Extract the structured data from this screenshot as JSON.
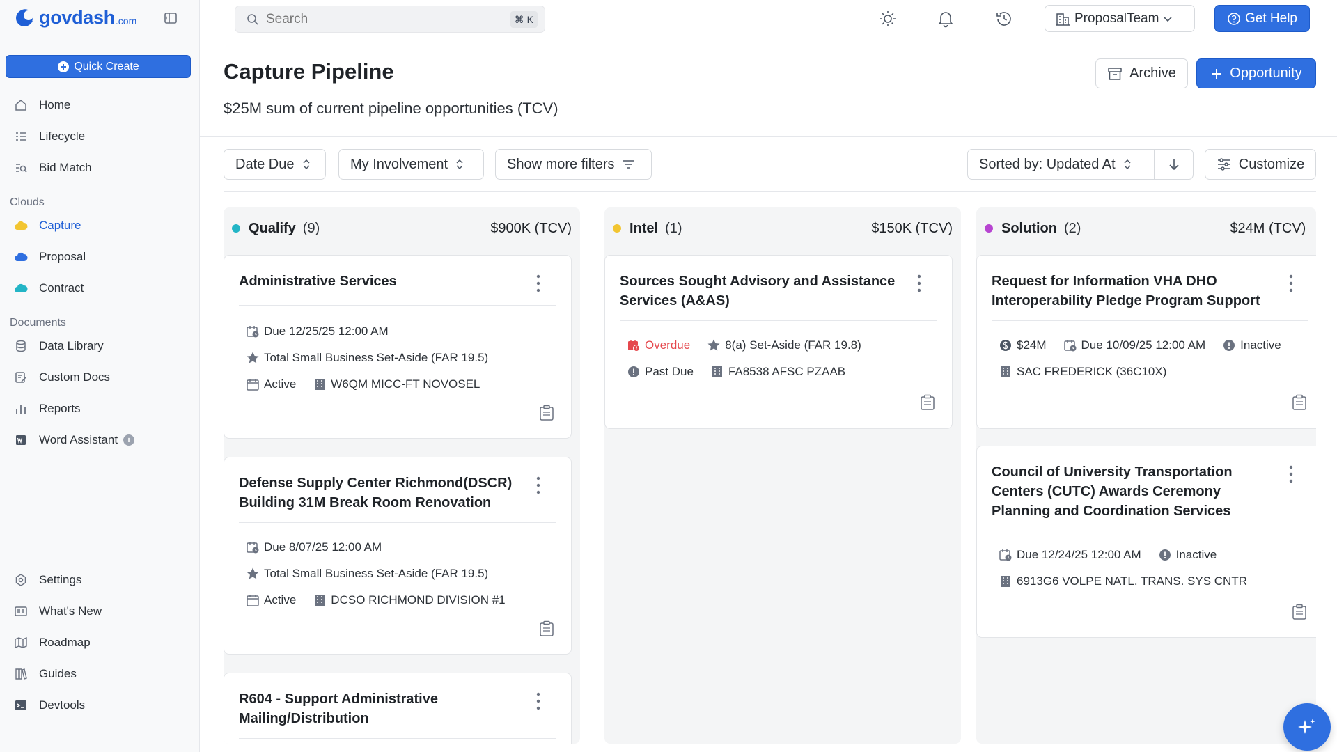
{
  "brand": {
    "name": "govdash",
    "suffix": ".com"
  },
  "sidebar": {
    "quick_create": "Quick Create",
    "main": [
      {
        "label": "Home"
      },
      {
        "label": "Lifecycle"
      },
      {
        "label": "Bid Match"
      }
    ],
    "clouds_label": "Clouds",
    "clouds": [
      {
        "label": "Capture"
      },
      {
        "label": "Proposal"
      },
      {
        "label": "Contract"
      }
    ],
    "documents_label": "Documents",
    "documents": [
      {
        "label": "Data Library"
      },
      {
        "label": "Custom Docs"
      },
      {
        "label": "Reports"
      },
      {
        "label": "Word Assistant"
      }
    ],
    "footer": [
      {
        "label": "Settings"
      },
      {
        "label": "What's New"
      },
      {
        "label": "Roadmap"
      },
      {
        "label": "Guides"
      },
      {
        "label": "Devtools"
      }
    ]
  },
  "topbar": {
    "search_placeholder": "Search",
    "search_shortcut": "⌘ K",
    "team": "ProposalTeam",
    "help": "Get Help"
  },
  "header": {
    "title": "Capture Pipeline",
    "subtitle": "$25M sum of current pipeline opportunities (TCV)",
    "archive": "Archive",
    "add_opportunity": "Opportunity"
  },
  "filters": {
    "date_due": "Date Due",
    "involvement": "My Involvement",
    "more": "Show more filters",
    "sorted": "Sorted by: Updated At",
    "customize": "Customize"
  },
  "colors": {
    "accent": "#2f6fe0",
    "qualify": "#23b5c6",
    "intel": "#f2c531",
    "solution": "#b744d1",
    "overdue": "#e5484d"
  },
  "columns": [
    {
      "name": "Qualify",
      "count": "(9)",
      "total": "$900K (TCV)",
      "cards": [
        {
          "title": "Administrative Services",
          "due": "Due 12/25/25 12:00 AM",
          "set_aside": "Total Small Business Set-Aside (FAR 19.5)",
          "status": "Active",
          "office": "W6QM MICC-FT NOVOSEL"
        },
        {
          "title": "Defense Supply Center Richmond(DSCR) Building 31M Break Room Renovation",
          "due": "Due 8/07/25 12:00 AM",
          "set_aside": "Total Small Business Set-Aside (FAR 19.5)",
          "status": "Active",
          "office": "DCSO RICHMOND DIVISION #1"
        },
        {
          "title": "R604 - Support Administrative Mailing/Distribution"
        }
      ]
    },
    {
      "name": "Intel",
      "count": "(1)",
      "total": "$150K (TCV)",
      "cards": [
        {
          "title": "Sources Sought Advisory and Assistance Services (A&AS)",
          "overdue": "Overdue",
          "set_aside": "8(a) Set-Aside (FAR 19.8)",
          "status": "Past Due",
          "office": "FA8538 AFSC PZAAB"
        }
      ]
    },
    {
      "name": "Solution",
      "count": "(2)",
      "total": "$24M (TCV)",
      "cards": [
        {
          "title": "Request for Information VHA DHO Interoperability Pledge Program Support",
          "value": "$24M",
          "due": "Due 10/09/25 12:00 AM",
          "status": "Inactive",
          "office": "SAC FREDERICK (36C10X)"
        },
        {
          "title": "Council of University Transportation Centers (CUTC) Awards Ceremony Planning and Coordination Services",
          "due": "Due 12/24/25 12:00 AM",
          "status": "Inactive",
          "office": "6913G6 VOLPE NATL. TRANS. SYS CNTR"
        }
      ]
    }
  ]
}
